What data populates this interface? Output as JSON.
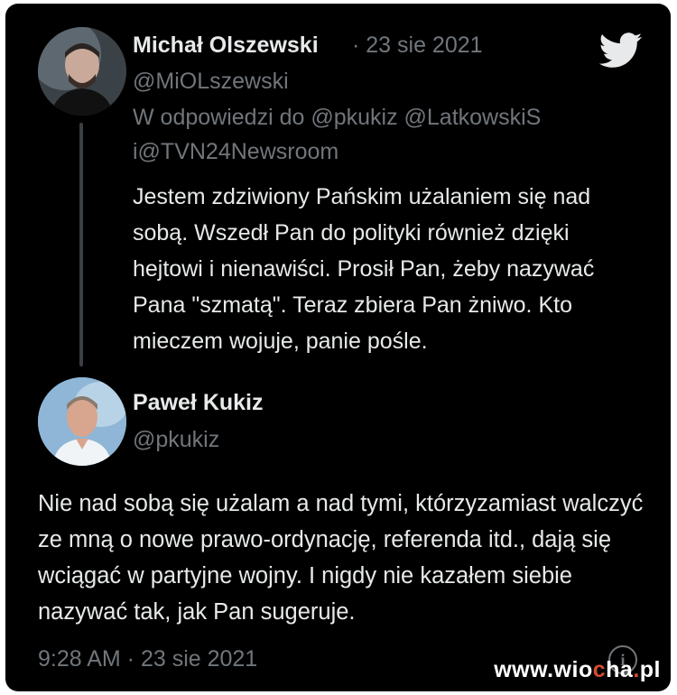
{
  "reply": {
    "author_name": "Michał Olszewski",
    "date": "· 23 sie 2021",
    "handle": "@MiOLszewski",
    "reply_to_line1": "W odpowiedzi do @pkukiz @LatkowskiS",
    "reply_to_line2": "i@TVN24Newsroom",
    "text": "Jestem zdziwiony Pańskim użalaniem się nad sobą. Wszedł Pan do polityki również dzięki hejtowi i nienawiści. Prosił Pan, żeby nazywać Pana \"szmatą\". Teraz zbiera Pan żniwo. Kto mieczem wojuje, panie pośle."
  },
  "main_tweet": {
    "author_name": "Paweł Kukiz",
    "handle": "@pkukiz",
    "text": "Nie nad sobą się użalam a nad tymi, którzyzamiast walczyć ze mną o nowe prawo-ordynację, referenda itd., dają się wciągać w partyjne wojny. I nigdy nie kazałem siebie nazywać tak, jak Pan sugeruje.",
    "timestamp": "9:28 AM · 23 sie 2021"
  },
  "icons": {
    "brand": "twitter-bird-icon",
    "info": "info-icon"
  },
  "colors": {
    "background": "#000000",
    "text_primary": "#e7e9ea",
    "text_secondary": "#71767b",
    "twitter_blue": "#1d9bf0"
  },
  "watermark": {
    "prefix": "www.wio",
    "mid": "c",
    "middle": "ha",
    "dot": ".",
    "suffix": "pl"
  }
}
